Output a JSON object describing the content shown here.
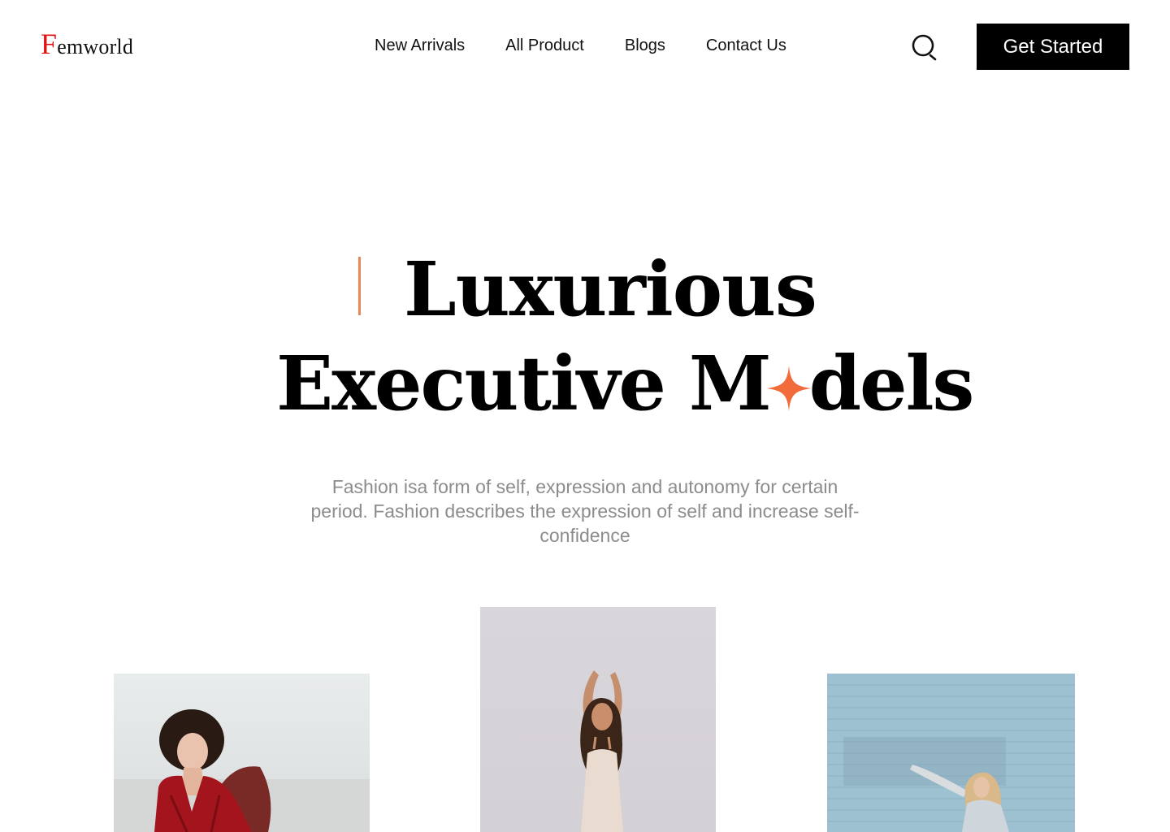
{
  "header": {
    "logo_initial": "F",
    "logo_rest": "emworld",
    "nav": [
      {
        "label": "New Arrivals"
      },
      {
        "label": "All Product"
      },
      {
        "label": "Blogs"
      },
      {
        "label": "Contact Us"
      }
    ],
    "search_icon": "search-icon",
    "cta_label": "Get Started"
  },
  "hero": {
    "line1": "Luxurious",
    "line2_pre": "Executive M",
    "line2_post": "dels",
    "accent_icon": "sparkle-star-icon",
    "subtitle": "Fashion isa form of self, expression and autonomy for certain period. Fashion describes the expression of self and increase self-confidence"
  },
  "colors": {
    "logo_accent": "#e01414",
    "accent_orange": "#f26b3a",
    "bar_accent": "#e7865a",
    "cta_bg": "#000000",
    "subtitle_gray": "#8c8c8c"
  },
  "photos": [
    {
      "name": "model-red-dress-photo"
    },
    {
      "name": "model-beige-dress-photo"
    },
    {
      "name": "model-blue-wall-photo"
    }
  ]
}
